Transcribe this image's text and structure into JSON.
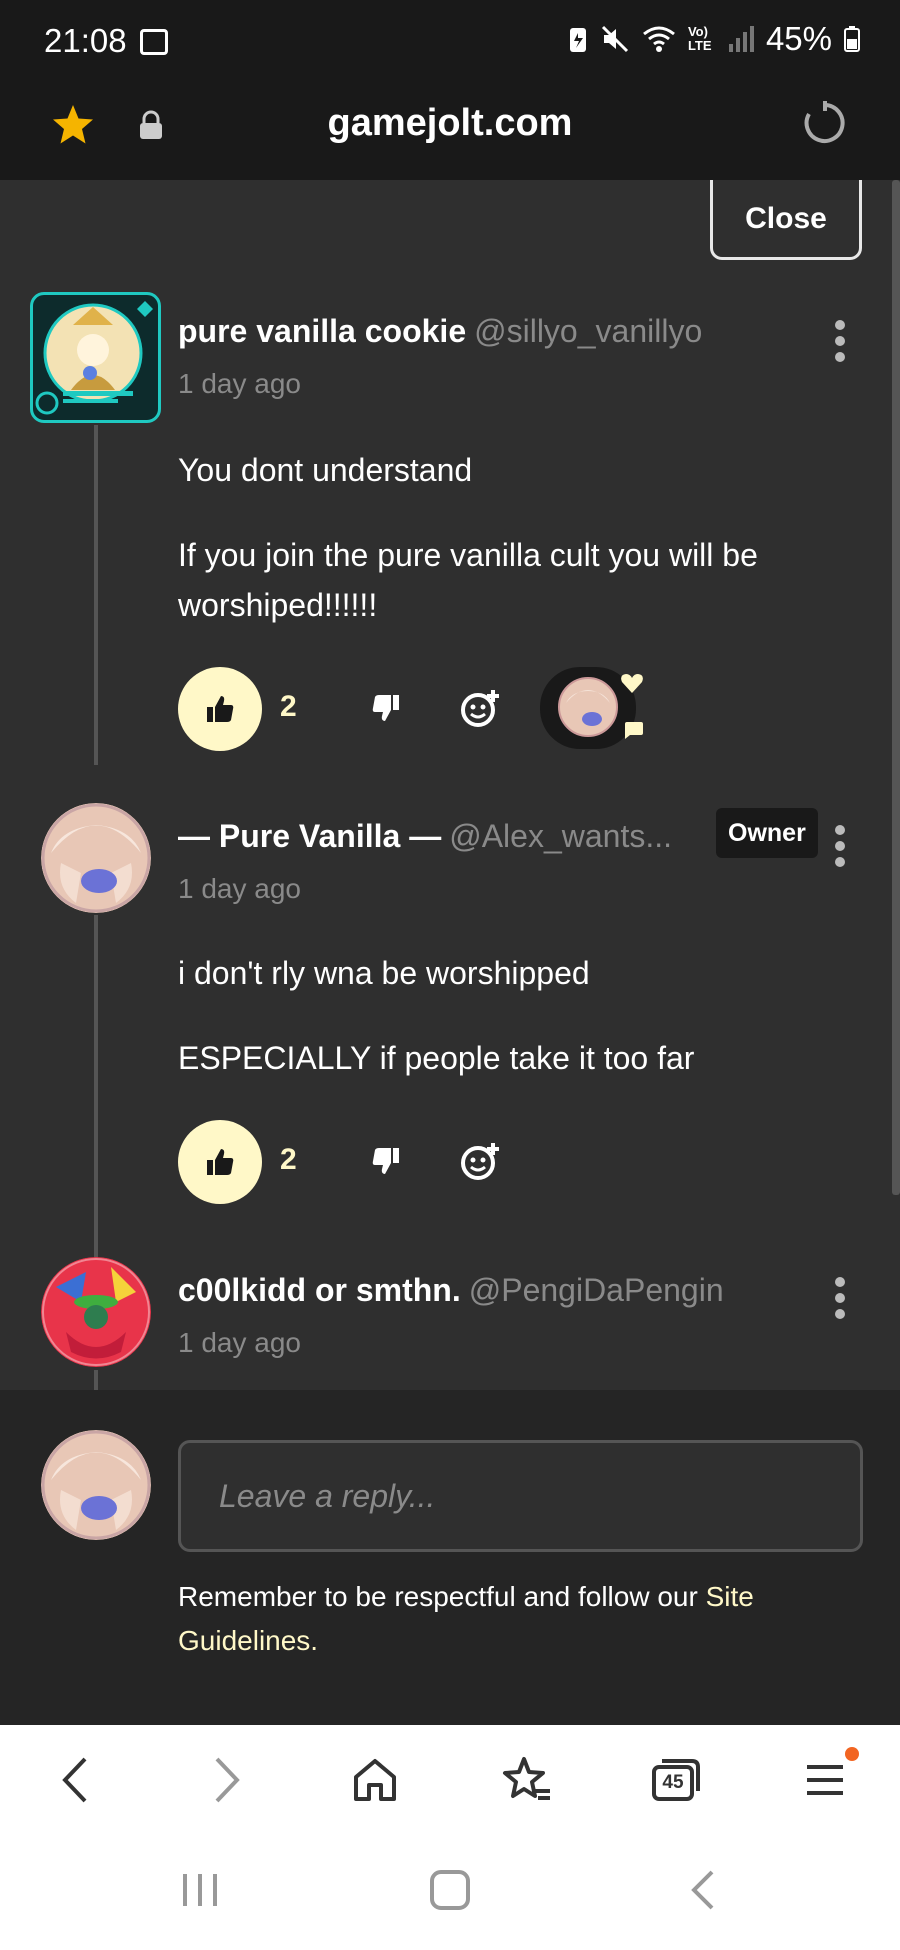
{
  "status_bar": {
    "time": "21:08",
    "battery": "45%",
    "signal_label": "Vo) LTE"
  },
  "browser": {
    "url": "gamejolt.com",
    "tab_count": "45"
  },
  "close_label": "Close",
  "comments": [
    {
      "name": "pure vanilla cookie",
      "handle": "@sillyo_vanillyo",
      "time": "1 day ago",
      "paragraphs": [
        "You dont understand",
        "If you join the pure vanilla cult you will be worshiped!!!!!!"
      ],
      "likes": "2",
      "liked": true
    },
    {
      "name": "— Pure Vanilla —",
      "handle": "@Alex_wants...",
      "badge": "Owner",
      "time": "1 day ago",
      "paragraphs": [
        "i don't rly wna be worshipped",
        "ESPECIALLY if people take it too far"
      ],
      "likes": "2",
      "liked": true
    },
    {
      "name": "c00lkidd or smthn.",
      "handle": "@PengiDaPengin",
      "time": "1 day ago"
    }
  ],
  "reply": {
    "placeholder": "Leave a reply...",
    "guidelines_text": "Remember to be respectful and follow our ",
    "guidelines_link": "Site Guidelines.",
    "link_color": "#fff8c8"
  },
  "colors": {
    "accent_yellow": "#fff8c8",
    "frame_teal": "#1fc9c1",
    "notification_dot": "#f26522"
  }
}
